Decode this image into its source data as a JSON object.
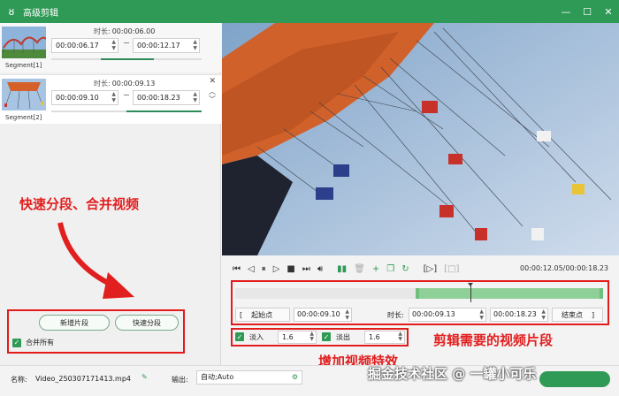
{
  "window": {
    "title": "高级剪辑",
    "icon": "rabbit-logo-icon",
    "accent": "#2f9a55"
  },
  "segments": [
    {
      "label": "Segment[1]",
      "duration_label": "时长:",
      "duration": "00:00:06.00",
      "start": "00:00:06.17",
      "end": "00:00:12.17",
      "progress_start": 0.33,
      "progress_end": 0.68
    },
    {
      "label": "Segment[2]",
      "duration_label": "时长:",
      "duration": "00:00:09.13",
      "start": "00:00:09.10",
      "end": "00:00:18.23",
      "progress_start": 0.5,
      "progress_end": 1.0
    }
  ],
  "annotations": {
    "left": "快速分段、合并视频",
    "right": "剪辑需要的视频片段",
    "bottom": "增加视频特效",
    "color": "#e21f1f"
  },
  "left_actions": {
    "add_segment": "新增片段",
    "quick_split": "快速分段",
    "merge_all": "合并所有",
    "merge_all_checked": true
  },
  "player": {
    "timecode": "00:00:12.05/00:00:18.23"
  },
  "timeline": {
    "sel_start": 0.49,
    "sel_end": 1.0,
    "playhead": 0.64
  },
  "range": {
    "start_btn": "起始点",
    "start_value": "00:00:09.10",
    "duration_label": "时长:",
    "duration_value": "00:00:09.13",
    "end_value": "00:00:18.23",
    "end_btn": "结束点"
  },
  "fades": {
    "fade_in_label": "淡入",
    "fade_in_value": "1.6",
    "fade_out_label": "淡出",
    "fade_out_value": "1.6"
  },
  "footer": {
    "name_label": "名称:",
    "name_value": "Video_250307171413.mp4",
    "output_label": "输出:",
    "output_value": "自动;Auto"
  },
  "watermark": {
    "text": "掘金技术社区 @ 一罐小可乐"
  }
}
